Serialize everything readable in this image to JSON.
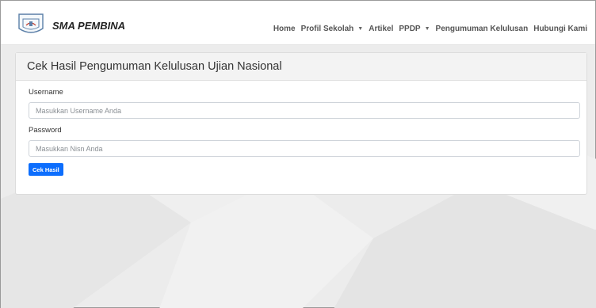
{
  "navbar": {
    "brand": "SMA PEMBINA",
    "logo_icon": "school-shield-logo-icon",
    "items": [
      {
        "label": "Home",
        "dropdown": false
      },
      {
        "label": "Profil Sekolah",
        "dropdown": true
      },
      {
        "label": "Artikel",
        "dropdown": false
      },
      {
        "label": "PPDP",
        "dropdown": true
      },
      {
        "label": "Pengumuman Kelulusan",
        "dropdown": false
      },
      {
        "label": "Hubungi Kami",
        "dropdown": false
      }
    ]
  },
  "card": {
    "title": "Cek Hasil Pengumuman Kelulusan Ujian Nasional",
    "username_label": "Username",
    "username_placeholder": "Masukkan Username Anda",
    "password_label": "Password",
    "password_placeholder": "Masukkan Nisn Anda",
    "submit_label": "Cek Hasil"
  },
  "colors": {
    "primary_button": "#0d6efd",
    "background": "#ececec",
    "card_header": "#f3f3f3"
  }
}
